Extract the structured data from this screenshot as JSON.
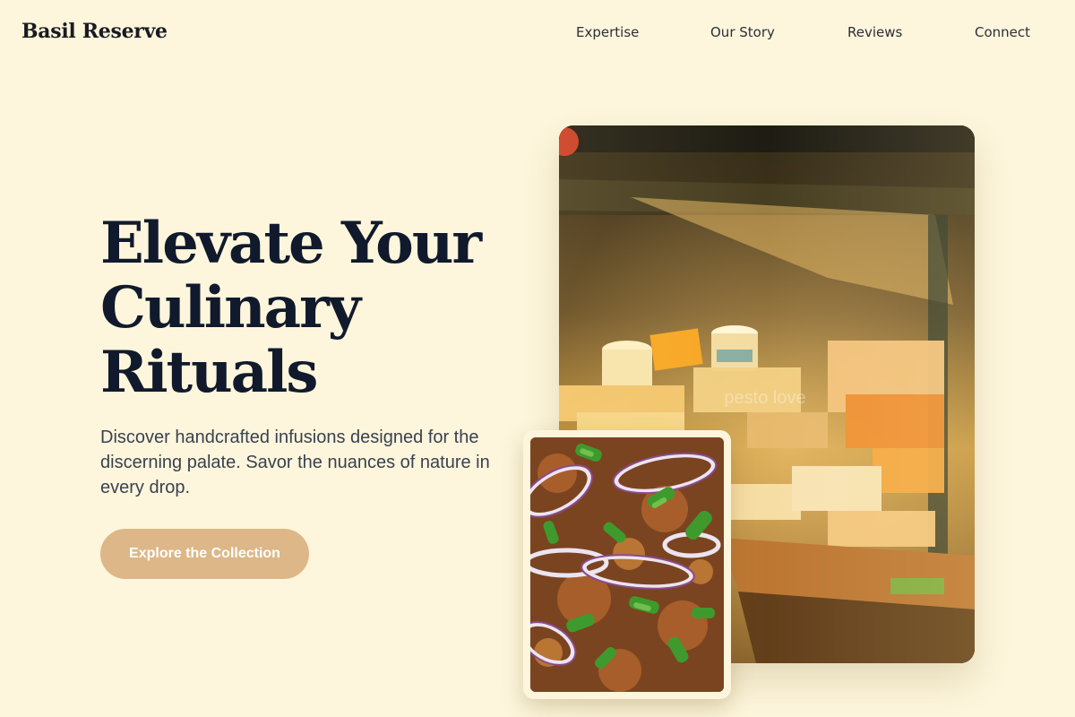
{
  "header": {
    "brand": "Basil Reserve",
    "nav": [
      {
        "label": "Expertise"
      },
      {
        "label": "Our Story"
      },
      {
        "label": "Reviews"
      },
      {
        "label": "Connect"
      }
    ]
  },
  "hero": {
    "title_lines": [
      "Elevate Your",
      "Culinary",
      "Rituals"
    ],
    "subtitle": "Discover handcrafted infusions designed for the discerning palate. Savor the nuances of nature in every drop.",
    "cta_label": "Explore the Collection"
  },
  "images": {
    "main": {
      "watermark": "pesto love",
      "icon": "cheese-display-photo"
    },
    "secondary": {
      "icon": "herb-salad-photo"
    }
  },
  "colors": {
    "background": "#fdf6dc",
    "heading": "#111a2c",
    "body_text": "#3a4150",
    "cta_background": "#ddb787",
    "cta_text": "#ffffff"
  }
}
